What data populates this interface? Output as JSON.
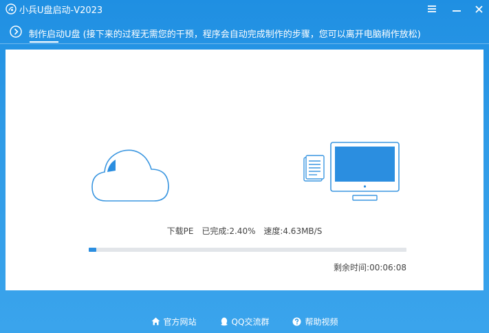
{
  "window": {
    "title": "小兵U盘启动-V2023"
  },
  "step": {
    "text": "制作启动U盘 (接下来的过程无需您的干预，程序会自动完成制作的步骤，您可以离开电脑稍作放松)"
  },
  "progress": {
    "task": "下载PE",
    "completed": "已完成:2.40%",
    "speed": "速度:4.63MB/S",
    "percent": 2.4,
    "remaining": "剩余时间:00:06:08"
  },
  "footer": {
    "official_site": "官方网站",
    "qq_group": "QQ交流群",
    "help_video": "帮助视频"
  },
  "colors": {
    "accent": "#2b8ee0",
    "background": "#2f9be7",
    "panel": "#ffffff"
  },
  "icons": {
    "app": "app-logo-icon",
    "menu": "menu-icon",
    "minimize": "minimize-icon",
    "close": "close-icon",
    "step": "chevron-right-circle-icon",
    "cloud": "cloud-icon",
    "document": "document-icon",
    "monitor": "monitor-icon",
    "home": "home-icon",
    "qq": "qq-icon",
    "help": "help-icon"
  }
}
